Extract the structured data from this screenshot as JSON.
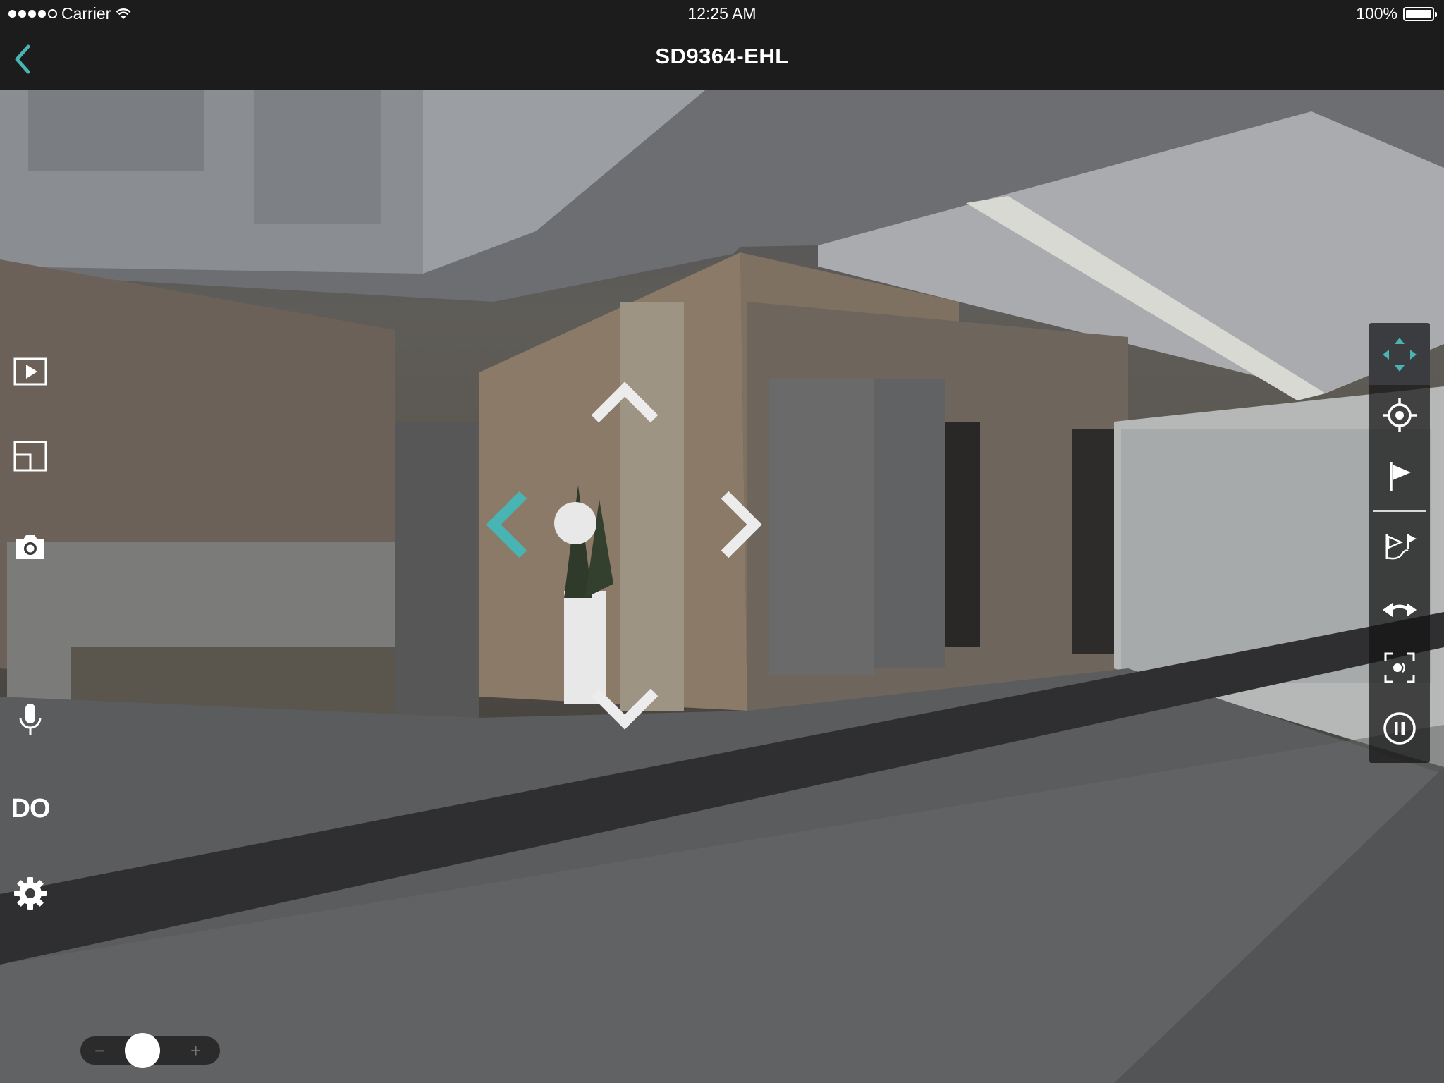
{
  "status_bar": {
    "carrier": "Carrier",
    "time": "12:25 AM",
    "battery": "100%",
    "battery_level": 1.0
  },
  "nav": {
    "title": "SD9364-EHL",
    "back_icon": "chevron-left-icon"
  },
  "left_toolbar": {
    "items": [
      {
        "name": "playback-icon"
      },
      {
        "name": "layout-icon"
      },
      {
        "name": "camera-icon"
      },
      {
        "name": "microphone-icon"
      },
      {
        "name": "digital-output",
        "label": "DO"
      },
      {
        "name": "gear-icon"
      }
    ]
  },
  "ptz": {
    "up": "chevron-up-icon",
    "down": "chevron-down-icon",
    "left": "chevron-left-icon",
    "right": "chevron-right-icon",
    "active_direction": "left"
  },
  "right_panel": {
    "items": [
      {
        "name": "pan-tilt-icon",
        "active": true
      },
      {
        "name": "crosshair-icon"
      },
      {
        "name": "preset-flag-icon"
      },
      {
        "name": "patrol-icon"
      },
      {
        "name": "auto-pan-icon"
      },
      {
        "name": "focus-icon"
      },
      {
        "name": "pause-icon"
      }
    ]
  },
  "zoom": {
    "minus": "−",
    "plus": "+",
    "level": 0.4
  },
  "colors": {
    "accent": "#49b4b4",
    "bar": "#1c1c1c"
  }
}
